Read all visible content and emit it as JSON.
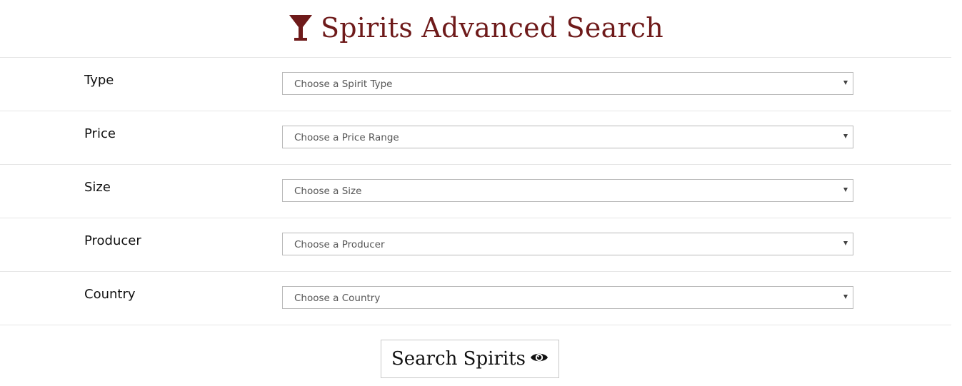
{
  "header": {
    "icon": "cocktail-glass-icon",
    "title": "Spirits Advanced Search"
  },
  "colors": {
    "brand": "#6e1a1a",
    "border": "#b9b9b9",
    "divider": "#e6e6e6"
  },
  "filters": [
    {
      "label": "Type",
      "placeholder": "Choose a Spirit Type"
    },
    {
      "label": "Price",
      "placeholder": "Choose a Price Range"
    },
    {
      "label": "Size",
      "placeholder": "Choose a Size"
    },
    {
      "label": "Producer",
      "placeholder": "Choose a Producer"
    },
    {
      "label": "Country",
      "placeholder": "Choose a Country"
    }
  ],
  "search_button": {
    "label": "Search Spirits",
    "icon": "eye-icon"
  }
}
